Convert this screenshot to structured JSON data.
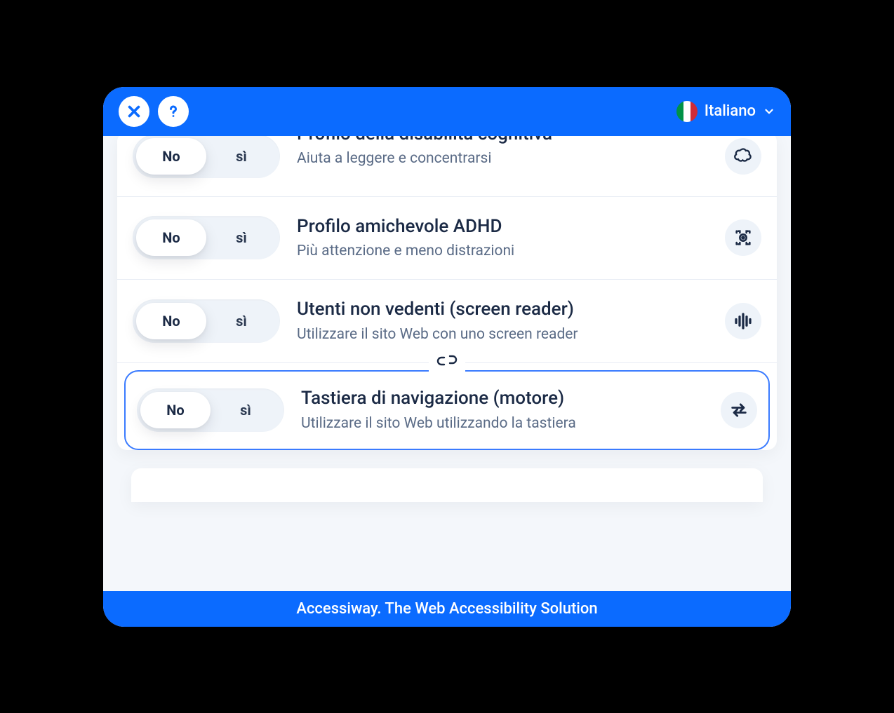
{
  "header": {
    "language_label": "Italiano"
  },
  "toggle": {
    "no_label": "No",
    "yes_label": "sì"
  },
  "profiles": [
    {
      "title": "Profilo della disabilità cognitiva",
      "subtitle": "Aiuta a leggere e concentrarsi",
      "icon": "cloud-icon",
      "focused": false,
      "clipped": true,
      "linked_below": false
    },
    {
      "title": "Profilo amichevole ADHD",
      "subtitle": "Più attenzione e meno distrazioni",
      "icon": "target-icon",
      "focused": false,
      "clipped": false,
      "linked_below": false
    },
    {
      "title": "Utenti non vedenti (screen reader)",
      "subtitle": "Utilizzare il sito Web con uno screen reader",
      "icon": "soundwave-icon",
      "focused": false,
      "clipped": false,
      "linked_below": true
    },
    {
      "title": "Tastiera di navigazione (motore)",
      "subtitle": "Utilizzare il sito Web utilizzando la tastiera",
      "icon": "arrows-icon",
      "focused": true,
      "clipped": false,
      "linked_below": false
    }
  ],
  "footer": {
    "text": "Accessiway. The Web Accessibility Solution"
  }
}
